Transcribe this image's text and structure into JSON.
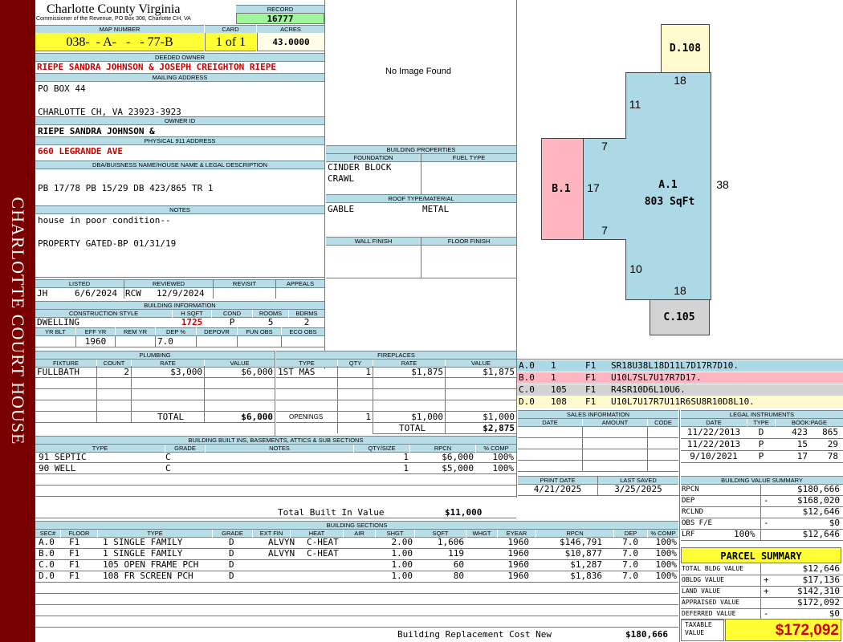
{
  "sidebar": {
    "text": "CHARLOTTE COURT HOUSE"
  },
  "header": {
    "county": "Charlotte County Virginia",
    "address": "Commissioner of the Revenue, PO Box 308, Charlotte CH, VA",
    "record_label": "RECORD",
    "record": "16777",
    "map_number_label": "MAP NUMBER",
    "map_number": "038-  - A-   -   - 77-B",
    "card_label": "CARD",
    "card": "1 of 1",
    "acres_label": "ACRES",
    "acres": "43.0000"
  },
  "owner": {
    "deeded_label": "DEEDED OWNER",
    "deeded": "RIEPE SANDRA JOHNSON & JOSEPH CREIGHTON RIEPE",
    "mailing_label": "MAILING ADDRESS",
    "mailing1": "PO BOX 44",
    "mailing2": "CHARLOTTE CH, VA 23923-3923",
    "owner_id_label": "OWNER ID",
    "owner_id": "RIEPE SANDRA JOHNSON &",
    "physical_label": "PHYSICAL 911 ADDRESS",
    "physical": "660 LEGRANDE AVE"
  },
  "legal": {
    "label": "DBA/BUISNESS NAME/HOUSE NAME & LEGAL DESCRIPTION",
    "text": "PB 17/78 PB 15/29 DB 423/865 TR 1"
  },
  "notes": {
    "label": "NOTES",
    "line1": "house in poor condition--",
    "line2": "PROPERTY GATED-BP 01/31/19"
  },
  "image": {
    "text": "No Image Found"
  },
  "building_props": {
    "label": "BUILDING PROPERTIES",
    "foundation_label": "FOUNDATION",
    "fuel_label": "FUEL TYPE",
    "foundation1": "CINDER BLOCK",
    "foundation2": "CRAWL",
    "roof_label": "ROOF TYPE/MATERIAL",
    "roof_type": "GABLE",
    "roof_material": "METAL",
    "wall_label": "WALL FINISH",
    "floor_label": "FLOOR FINISH"
  },
  "listing": {
    "listed_label": "LISTED",
    "reviewed_label": "REVIEWED",
    "revisit_label": "REVISIT",
    "appeals_label": "APPEALS",
    "listed_by": "JH",
    "listed_date": "6/6/2024",
    "reviewed_by": "RCW",
    "reviewed_date": "12/9/2024"
  },
  "building_info": {
    "label": "BUILDING INFORMATION",
    "style_label": "CONSTRUCTION STYLE",
    "hsqft_label": "H SQFT",
    "cond_label": "COND",
    "rooms_label": "ROOMS",
    "bdrms_label": "BDRMS",
    "style": "DWELLING",
    "hsqft": "1725",
    "cond": "P",
    "rooms": "5",
    "bdrms": "2",
    "yrblt_label": "YR BLT",
    "effyr_label": "EFF YR",
    "remyr_label": "REM YR",
    "dep_label": "DEP %",
    "depovr_label": "DEPOVR",
    "funobs_label": "FUN OBS",
    "ecoobs_label": "ECO OBS",
    "effyr": "1960",
    "dep": "7.0"
  },
  "plumbing": {
    "label": "PLUMBING",
    "cols": [
      "FIXTURE",
      "COUNT",
      "RATE",
      "VALUE"
    ],
    "rows": [
      {
        "fixture": "FULLBATH",
        "count": "2",
        "rate": "$3,000",
        "value": "$6,000"
      }
    ],
    "total_label": "TOTAL",
    "total": "$6,000"
  },
  "fireplaces": {
    "label": "FIREPLACES",
    "cols": [
      "TYPE",
      "QTY",
      "RATE",
      "VALUE"
    ],
    "rows": [
      {
        "type": "1ST MAS",
        "qty": "1",
        "rate": "$1,875",
        "value": "$1,875"
      }
    ],
    "openings_label": "OPENINGS",
    "openings_qty": "1",
    "openings_rate": "$1,000",
    "openings_value": "$1,000",
    "total_label": "TOTAL",
    "total": "$2,875"
  },
  "builtins": {
    "label": "BUILDING BUILT INS, BASEMENTS, ATTICS & SUB SECTIONS",
    "cols": [
      "TYPE",
      "GRADE",
      "NOTES",
      "QTY/SIZE",
      "RPCN",
      "% COMP"
    ],
    "rows": [
      {
        "type": "91 SEPTIC",
        "grade": "C",
        "qty": "1",
        "rpcn": "$6,000",
        "comp": "100%"
      },
      {
        "type": "90 WELL",
        "grade": "C",
        "qty": "1",
        "rpcn": "$5,000",
        "comp": "100%"
      }
    ],
    "total_label": "Total Built In Value",
    "total": "$11,000"
  },
  "sketch": {
    "sections": [
      {
        "name": "D.108"
      },
      {
        "name": "A.1",
        "area": "803 SqFt"
      },
      {
        "name": "B.1"
      },
      {
        "name": "C.105"
      }
    ],
    "dims": [
      "18",
      "11",
      "7",
      "17",
      "38",
      "7",
      "10",
      "18"
    ],
    "colors": {
      "main": "#add8e6",
      "b": "#ffb6c1",
      "c": "#d3d3d3",
      "d": "#fffacd"
    }
  },
  "sketch_legend": [
    {
      "id": "A.0",
      "n": "1",
      "f": "F1",
      "code": "SR18U38L18D11L7D17R7D10.",
      "color": "#add8e6"
    },
    {
      "id": "B.0",
      "n": "1",
      "f": "F1",
      "code": "U10L7SL7U17R7D17.",
      "color": "#ffb6c1"
    },
    {
      "id": "C.0",
      "n": "105",
      "f": "F1",
      "code": "R4SR10D6L10U6.",
      "color": "#d3d3d3"
    },
    {
      "id": "D.0",
      "n": "108",
      "f": "F1",
      "code": "U10L7U17R7U11R6SU8R10D8L10.",
      "color": "#fffacd"
    }
  ],
  "sales": {
    "label": "SALES INFORMATION",
    "cols": [
      "DATE",
      "AMOUNT",
      "CODE"
    ]
  },
  "legal_instruments": {
    "label": "LEGAL INSTRUMENTS",
    "cols": [
      "DATE",
      "TYPE",
      "BOOK:PAGE"
    ],
    "rows": [
      {
        "date": "11/22/2013",
        "type": "D",
        "book": "423",
        "page": "865"
      },
      {
        "date": "11/22/2013",
        "type": "P",
        "book": "15",
        "page": "29"
      },
      {
        "date": "9/10/2021",
        "type": "P",
        "book": "17",
        "page": "78"
      }
    ]
  },
  "print": {
    "print_label": "PRINT DATE",
    "saved_label": "LAST SAVED",
    "print_date": "4/21/2025",
    "saved_date": "3/25/2025"
  },
  "value_summary": {
    "label": "BUILDING VALUE SUMMARY",
    "rows": [
      {
        "label": "RPCN",
        "sign": "",
        "value": "$180,666"
      },
      {
        "label": "DEP",
        "sign": "-",
        "value": "$168,020"
      },
      {
        "label": "RCLND",
        "sign": "",
        "value": "$12,646"
      },
      {
        "label": "OBS F/E",
        "sign": "-",
        "value": "$0"
      },
      {
        "label": "LRF",
        "pct": "100%",
        "sign": "",
        "value": "$12,646"
      }
    ]
  },
  "parcel_summary": {
    "label": "PARCEL SUMMARY",
    "rows": [
      {
        "label": "TOTAL BLDG VALUE",
        "sign": "",
        "value": "$12,646"
      },
      {
        "label": "OBLDG VALUE",
        "sign": "+",
        "value": "$17,136"
      },
      {
        "label": "LAND VALUE",
        "sign": "+",
        "value": "$142,310"
      },
      {
        "label": "APPRAISED VALUE",
        "sign": "",
        "value": "$172,092"
      },
      {
        "label": "DEFERRED VALUE",
        "sign": "-",
        "value": "$0"
      }
    ],
    "taxable_label1": "TAXABLE",
    "taxable_label2": "VALUE",
    "taxable": "$172,092"
  },
  "sections": {
    "label": "BUILDING SECTIONS",
    "cols": [
      "SEC#",
      "FLOOR",
      "TYPE",
      "GRADE",
      "EXT FIN",
      "HEAT",
      "AIR",
      "SHGT",
      "SQFT",
      "WHGT",
      "EYEAR",
      "RPCN",
      "DEP",
      "% COMP"
    ],
    "rows": [
      {
        "sec": "A.0",
        "floor": "F1",
        "type": "1 SINGLE FAMILY",
        "grade": "D",
        "ext": "ALVYN",
        "heat": "C-HEAT",
        "shgt": "2.00",
        "sqft": "1,606",
        "eyear": "1960",
        "rpcn": "$146,791",
        "dep": "7.0",
        "comp": "100%"
      },
      {
        "sec": "B.0",
        "floor": "F1",
        "type": "1 SINGLE FAMILY",
        "grade": "D",
        "ext": "ALVYN",
        "heat": "C-HEAT",
        "shgt": "1.00",
        "sqft": "119",
        "eyear": "1960",
        "rpcn": "$10,877",
        "dep": "7.0",
        "comp": "100%"
      },
      {
        "sec": "C.0",
        "floor": "F1",
        "type": "105 OPEN FRAME PCH",
        "grade": "D",
        "ext": "",
        "heat": "",
        "shgt": "1.00",
        "sqft": "60",
        "eyear": "1960",
        "rpcn": "$1,287",
        "dep": "7.0",
        "comp": "100%"
      },
      {
        "sec": "D.0",
        "floor": "F1",
        "type": "108 FR SCREEN PCH",
        "grade": "D",
        "ext": "",
        "heat": "",
        "shgt": "1.00",
        "sqft": "80",
        "eyear": "1960",
        "rpcn": "$1,836",
        "dep": "7.0",
        "comp": "100%"
      }
    ],
    "total_label": "Building Replacement Cost New",
    "total": "$180,666"
  }
}
